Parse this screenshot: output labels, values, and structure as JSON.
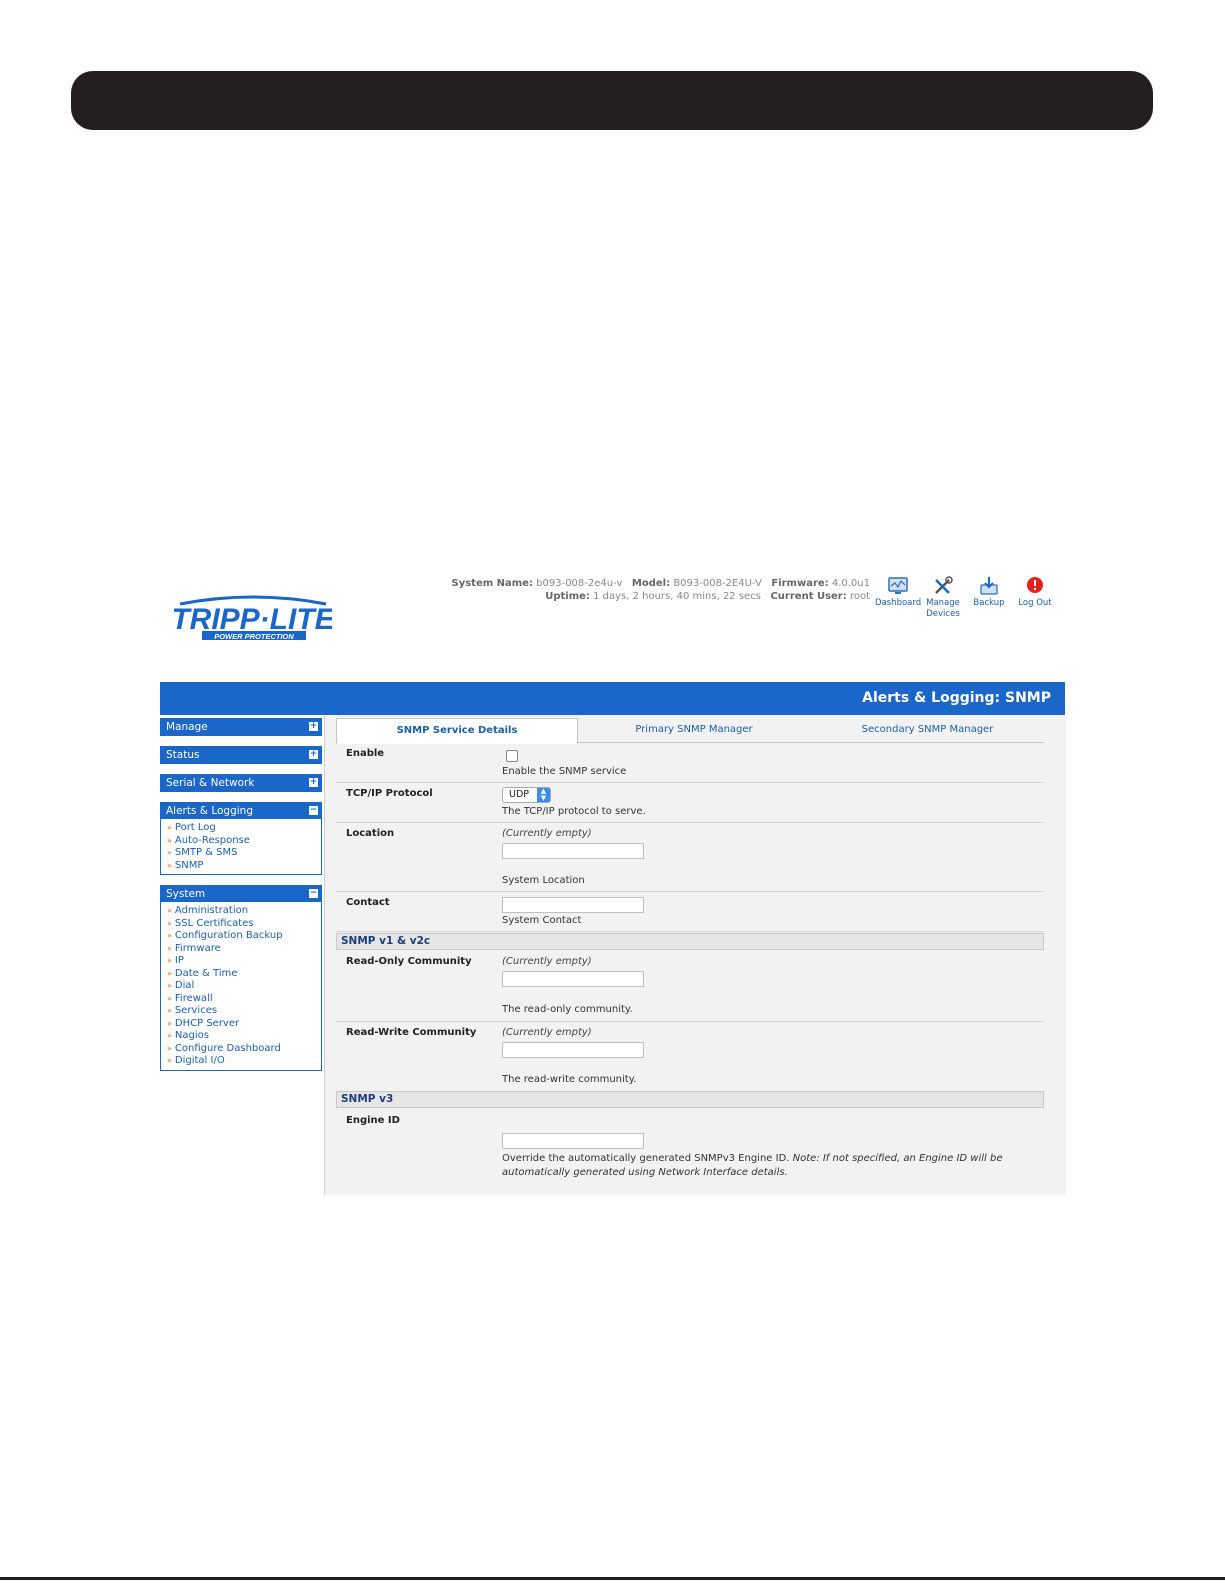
{
  "app": {
    "logo_text": "TRIPP·LITE",
    "logo_sub": "POWER PROTECTION",
    "page_title": "Alerts & Logging: SNMP"
  },
  "sysinfo": {
    "system_name_label": "System Name",
    "system_name": "b093-008-2e4u-v",
    "model_label": "Model",
    "model": "B093-008-2E4U-V",
    "firmware_label": "Firmware",
    "firmware": "4.0.0u1",
    "uptime_label": "Uptime",
    "uptime": "1 days, 2 hours, 40 mins, 22 secs",
    "user_label": "Current User",
    "user": "root"
  },
  "toolbar": {
    "dashboard": "Dashboard",
    "manage_devices_1": "Manage",
    "manage_devices_2": "Devices",
    "backup": "Backup",
    "logout": "Log Out"
  },
  "sidebar": {
    "manage": "Manage",
    "status": "Status",
    "serial_network": "Serial & Network",
    "alerts_logging": "Alerts & Logging",
    "alerts_items": [
      "Port Log",
      "Auto-Response",
      "SMTP & SMS",
      "SNMP"
    ],
    "system": "System",
    "system_items": [
      "Administration",
      "SSL Certificates",
      "Configuration Backup",
      "Firmware",
      "IP",
      "Date & Time",
      "Dial",
      "Firewall",
      "Services",
      "DHCP Server",
      "Nagios",
      "Configure Dashboard",
      "Digital I/O"
    ],
    "expand_symbol": "+",
    "collapse_symbol": "−",
    "arrow_symbol": "»"
  },
  "tabs": [
    "SNMP Service Details",
    "Primary SNMP Manager",
    "Secondary SNMP Manager"
  ],
  "form": {
    "enable_label": "Enable",
    "enable_desc": "Enable the SNMP service",
    "protocol_label": "TCP/IP Protocol",
    "protocol_value": "UDP",
    "protocol_desc": "The TCP/IP protocol to serve.",
    "location_label": "Location",
    "location_note": "(Currently empty)",
    "location_desc": "System Location",
    "contact_label": "Contact",
    "contact_desc": "System Contact",
    "section_v1": "SNMP v1 & v2c",
    "ro_label": "Read-Only Community",
    "ro_note": "(Currently empty)",
    "ro_desc": "The read-only community.",
    "rw_label": "Read-Write Community",
    "rw_note": "(Currently empty)",
    "rw_desc": "The read-write community.",
    "section_v3": "SNMP v3",
    "engine_label": "Engine ID",
    "engine_desc_1": "Override the automatically generated SNMPv3 Engine ID.",
    "engine_note_1": "Note: If not specified, an Engine ID will be",
    "engine_note_2": "automatically generated using Network Interface details."
  },
  "colors": {
    "brand_blue": "#1a66c9",
    "link_blue": "#1c5fa8",
    "arrow_orange": "#e36a1c",
    "logout_red": "#e0201b"
  }
}
